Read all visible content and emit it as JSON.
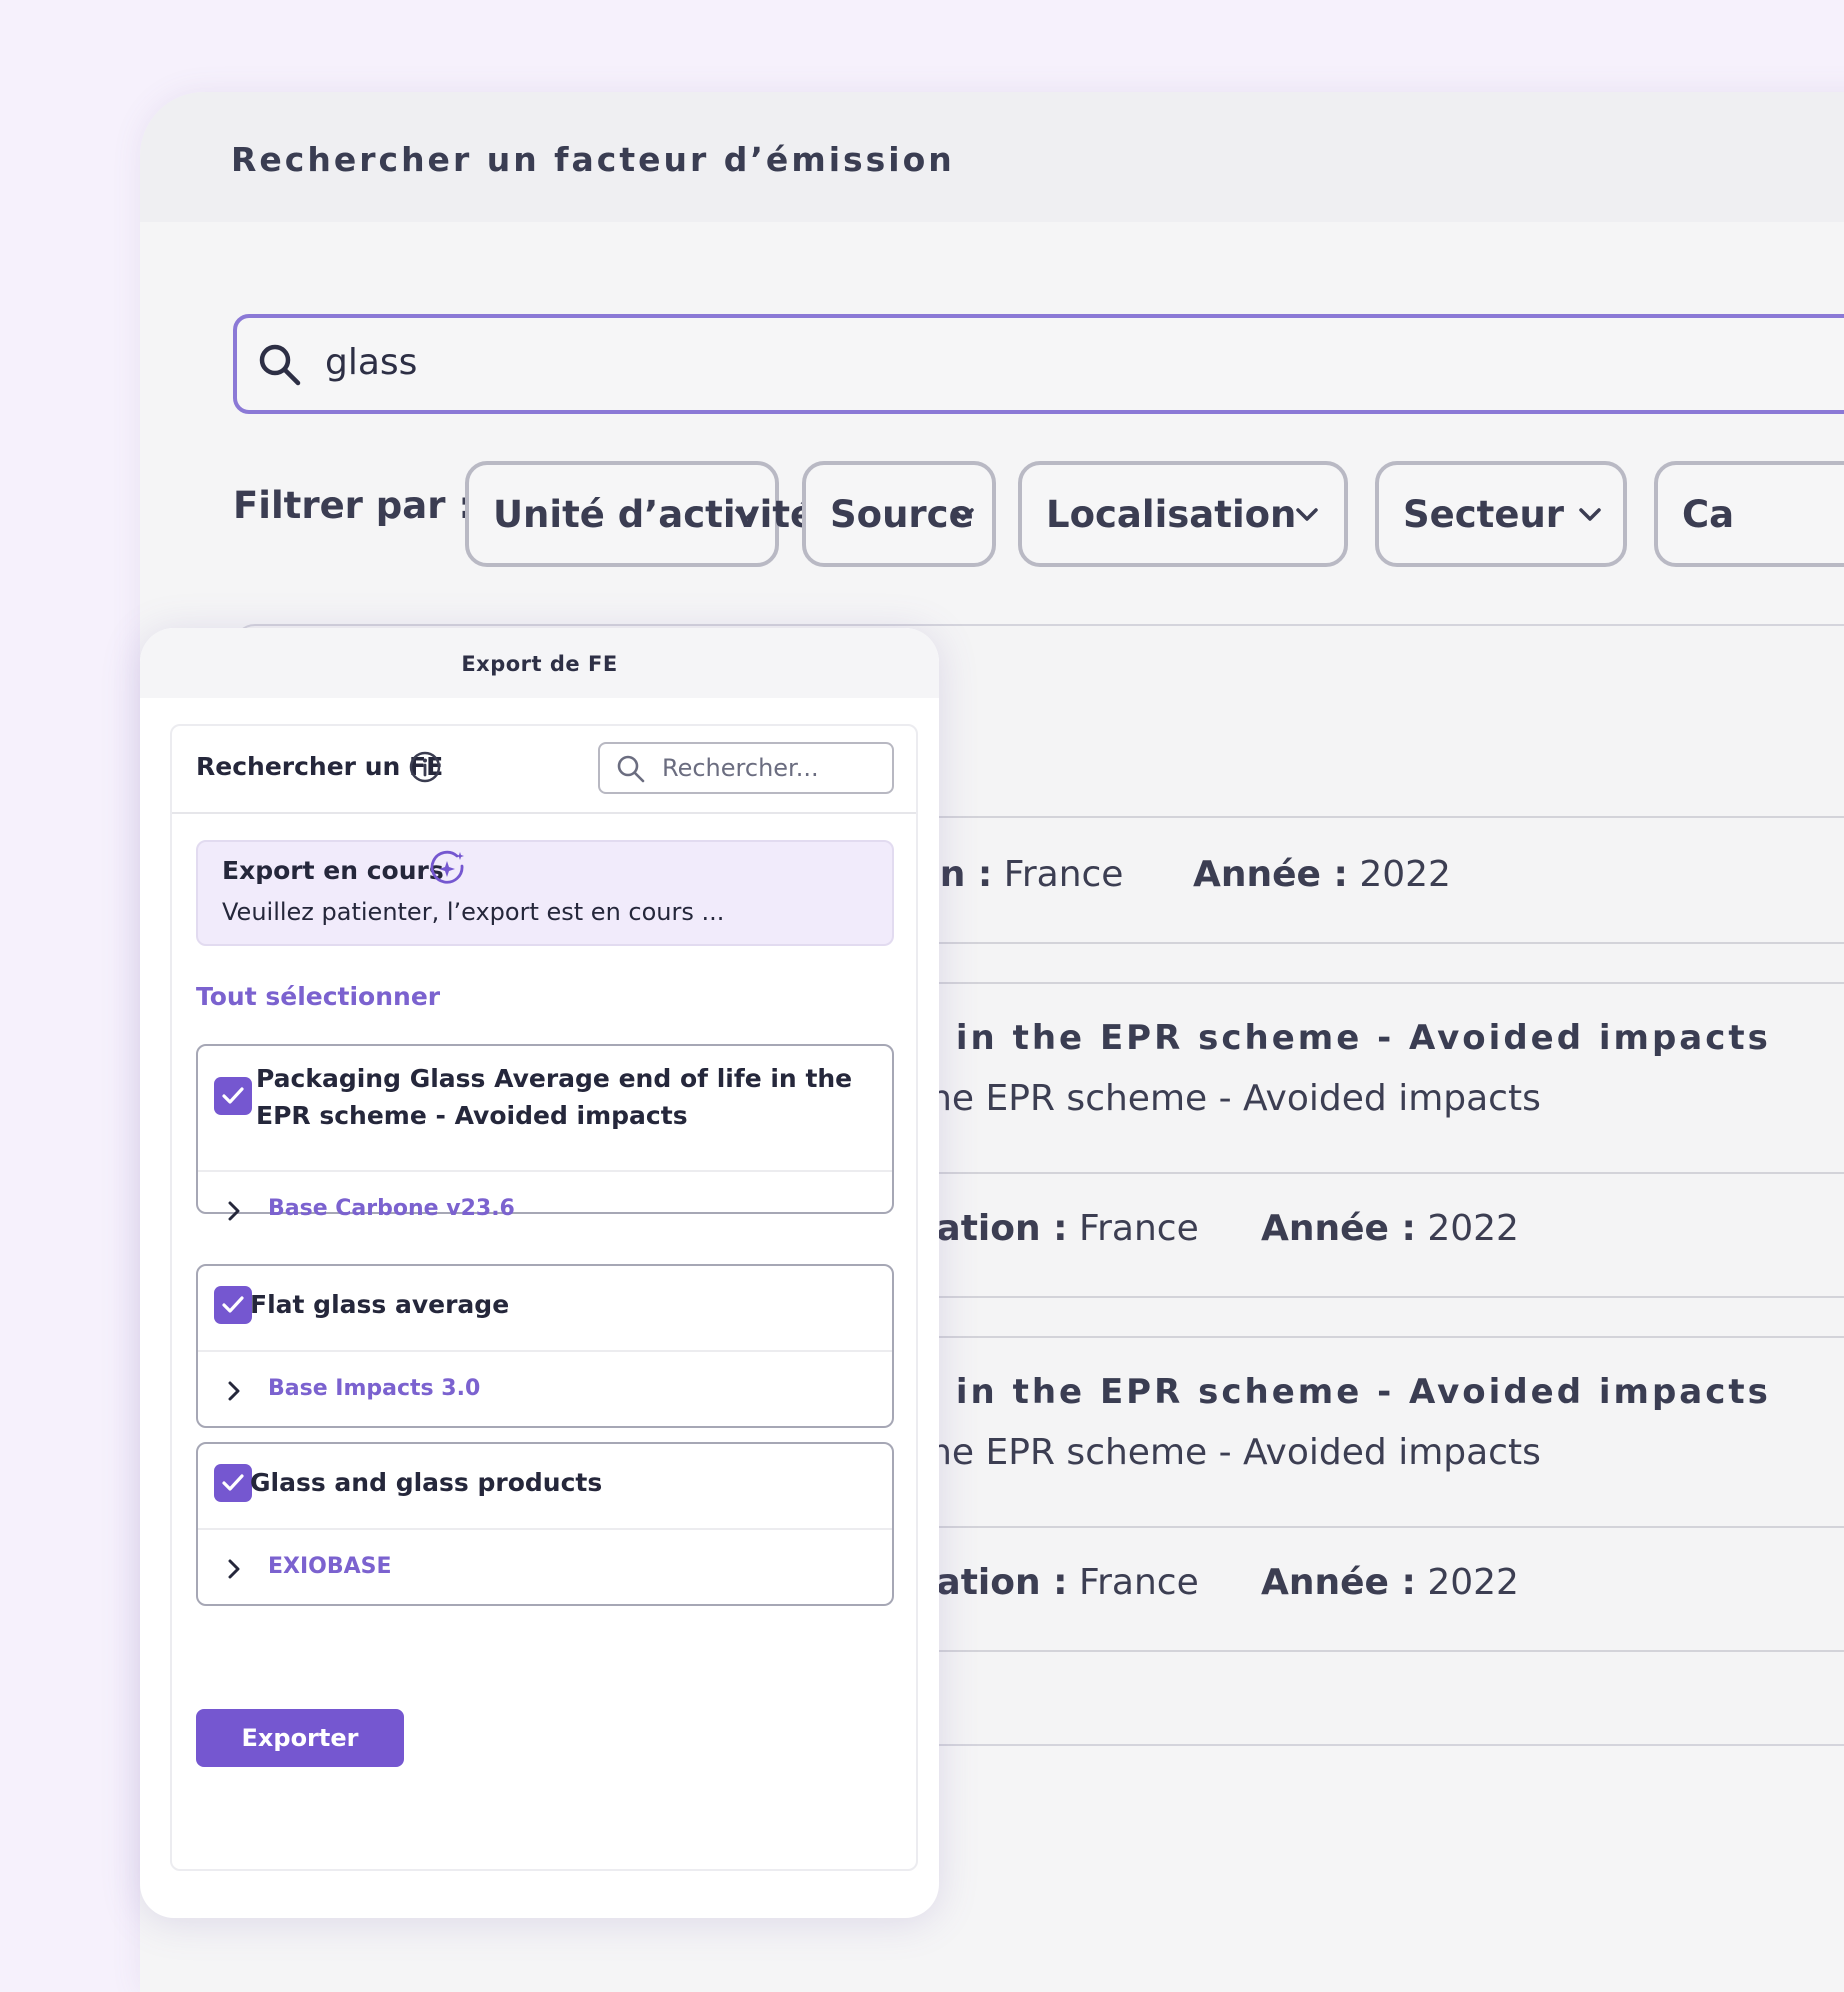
{
  "main": {
    "title": "Rechercher un facteur d’émission",
    "search": {
      "value": "glass"
    },
    "filter_label": "Filtrer par :",
    "filters": [
      {
        "label": "Unité d’activité"
      },
      {
        "label": "Source"
      },
      {
        "label": "Localisation"
      },
      {
        "label": "Secteur"
      },
      {
        "label": "Ca"
      }
    ],
    "results": [
      {
        "location_key": "on :",
        "location_value": "France",
        "year_key": "Année :",
        "year_value": "2022"
      },
      {
        "title": "e in the EPR scheme - Avoided impacts",
        "subtitle": "the EPR scheme - Avoided impacts",
        "location_key": "sation :",
        "location_value": "France",
        "year_key": "Année :",
        "year_value": "2022"
      },
      {
        "title": "e in the EPR scheme - Avoided impacts",
        "subtitle": "the EPR scheme - Avoided impacts",
        "location_key": "sation :",
        "location_value": "France",
        "year_key": "Année :",
        "year_value": "2022"
      }
    ]
  },
  "export_panel": {
    "title": "Export de FE",
    "search_label": "Rechercher un FE",
    "search_placeholder": "Rechercher...",
    "status": {
      "title": "Export en cours",
      "text": "Veuillez patienter, l’export est en cours ..."
    },
    "select_all": "Tout sélectionner",
    "items": [
      {
        "name": "Packaging Glass Average end of life in the EPR scheme - Avoided impacts",
        "source": "Base Carbone v23.6",
        "checked": true
      },
      {
        "name": "Flat glass average",
        "source": "Base Impacts 3.0",
        "checked": true
      },
      {
        "name": "Glass and glass products",
        "source": "EXIOBASE",
        "checked": true
      }
    ],
    "export_button": "Exporter"
  },
  "colors": {
    "accent": "#7557d0",
    "link": "#7b62cf",
    "search_border": "#8b79d6",
    "page_background": "#f6f1fc",
    "status_background": "#f1ebfb"
  },
  "icons": [
    "search-icon",
    "chevron-down-icon",
    "info-icon",
    "sparkle-icon",
    "check-icon",
    "chevron-right-icon"
  ]
}
